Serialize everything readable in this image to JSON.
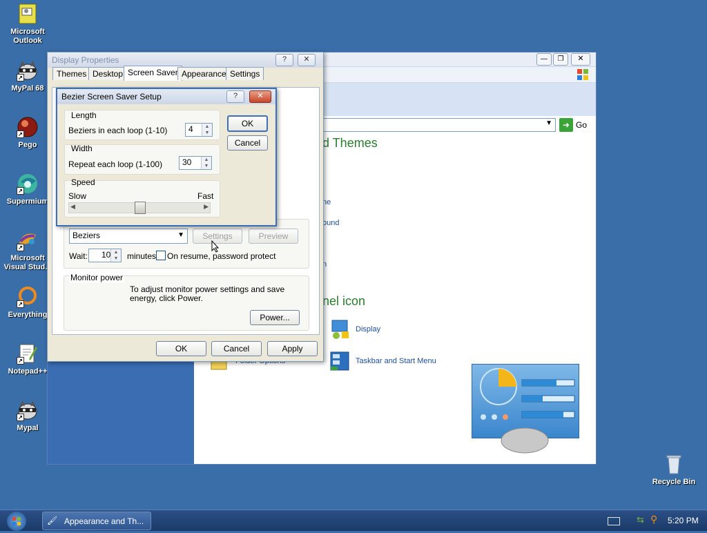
{
  "desktop": {
    "icons": [
      {
        "label": "Microsoft Outlook",
        "icon": "outlook-icon"
      },
      {
        "label": "MyPal 68",
        "icon": "raccoon-icon"
      },
      {
        "label": "Pego",
        "icon": "pego-icon"
      },
      {
        "label": "Supermium",
        "icon": "supermium-icon"
      },
      {
        "label": "Microsoft Visual Stud...",
        "icon": "visual-studio-icon"
      },
      {
        "label": "Everything",
        "icon": "everything-icon"
      },
      {
        "label": "Notepad++",
        "icon": "notepadpp-icon"
      },
      {
        "label": "Mypal",
        "icon": "raccoon-icon"
      }
    ],
    "recycle_bin": "Recycle Bin"
  },
  "background_window": {
    "address_go": "Go",
    "heading1": "d Themes",
    "link1": "ne",
    "link2": "ound",
    "link3": "n",
    "heading2": "nel icon",
    "items": [
      "Display",
      "Taskbar and Start Menu"
    ],
    "partial_item": "Folder Options"
  },
  "display_properties": {
    "title": "Display Properties",
    "tabs": [
      "Themes",
      "Desktop",
      "Screen Saver",
      "Appearance",
      "Settings"
    ],
    "selected_tab": "Screen Saver",
    "screensaver_select": "Beziers",
    "settings_label": "Settings",
    "preview_label": "Preview",
    "wait_label": "Wait:",
    "wait_value": "10",
    "minutes_label": "minutes",
    "resume_label": "On resume, password protect",
    "resume_checked": false,
    "monitor_power_label": "Monitor power",
    "monitor_power_text": "To adjust monitor power settings and save energy, click Power.",
    "power_button": "Power...",
    "ok": "OK",
    "cancel": "Cancel",
    "apply": "Apply"
  },
  "bezier_setup": {
    "title": "Bezier Screen Saver Setup",
    "length_group": "Length",
    "beziers_label": "Beziers in each loop (1-10)",
    "beziers_value": "4",
    "width_group": "Width",
    "repeat_label": "Repeat each loop (1-100)",
    "repeat_value": "30",
    "speed_group": "Speed",
    "slow": "Slow",
    "fast": "Fast",
    "speed_level": 0.5,
    "ok": "OK",
    "cancel": "Cancel"
  },
  "taskbar": {
    "window_button": "Appearance and Th...",
    "clock": "5:20 PM"
  },
  "colors": {
    "desktop": "#3a6ea8",
    "green_heading": "#2a7d2e",
    "link": "#1f4f9a"
  }
}
